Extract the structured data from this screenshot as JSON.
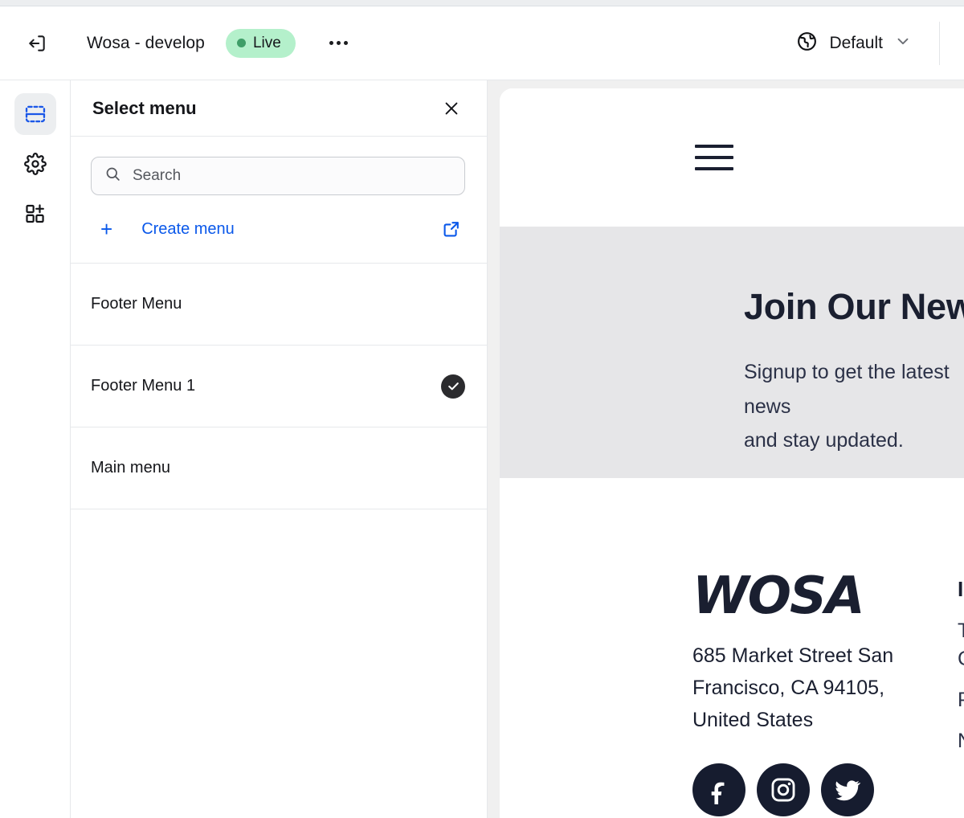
{
  "header": {
    "exit_icon": "exit-icon",
    "site_title": "Wosa - develop",
    "status_badge": "Live",
    "more_icon": "more-horizontal-icon",
    "market_icon": "globe-icon",
    "market_label": "Default",
    "market_chevron": "chevron-down-icon"
  },
  "rail": {
    "items": [
      {
        "icon": "sections-icon",
        "name": "sidebar-item-sections",
        "active": true
      },
      {
        "icon": "gear-icon",
        "name": "sidebar-item-settings",
        "active": false
      },
      {
        "icon": "add-app-icon",
        "name": "sidebar-item-apps",
        "active": false
      }
    ]
  },
  "panel": {
    "title": "Select menu",
    "close_icon": "close-icon",
    "search": {
      "icon": "search-icon",
      "placeholder": "Search",
      "value": ""
    },
    "create": {
      "plus": "+",
      "label": "Create menu",
      "external_icon": "external-link-icon"
    },
    "menus": [
      {
        "label": "Footer Menu",
        "selected": false
      },
      {
        "label": "Footer Menu 1",
        "selected": true
      },
      {
        "label": "Main menu",
        "selected": false
      }
    ]
  },
  "preview": {
    "hamburger_icon": "hamburger-menu-icon",
    "newsletter": {
      "title": "Join Our Newsletter",
      "subtitle": "Signup to get the latest news\nand stay updated."
    },
    "footer": {
      "logo_text": "WOSA",
      "address": "685 Market Street San\nFrancisco, CA 94105,\nUnited States",
      "social": [
        {
          "name": "facebook-icon"
        },
        {
          "name": "instagram-icon"
        },
        {
          "name": "twitter-icon"
        }
      ],
      "links_heading": "INFORMATION",
      "links": [
        "Terms &",
        "Conditions",
        "Privacy Policy",
        "News"
      ]
    }
  },
  "colors": {
    "accent": "#0a58ea",
    "live_badge_bg": "#b4f0cb",
    "live_dot": "#3f9e68",
    "brand_navy": "#1a1f30",
    "check_badge": "#2b2b2e"
  }
}
